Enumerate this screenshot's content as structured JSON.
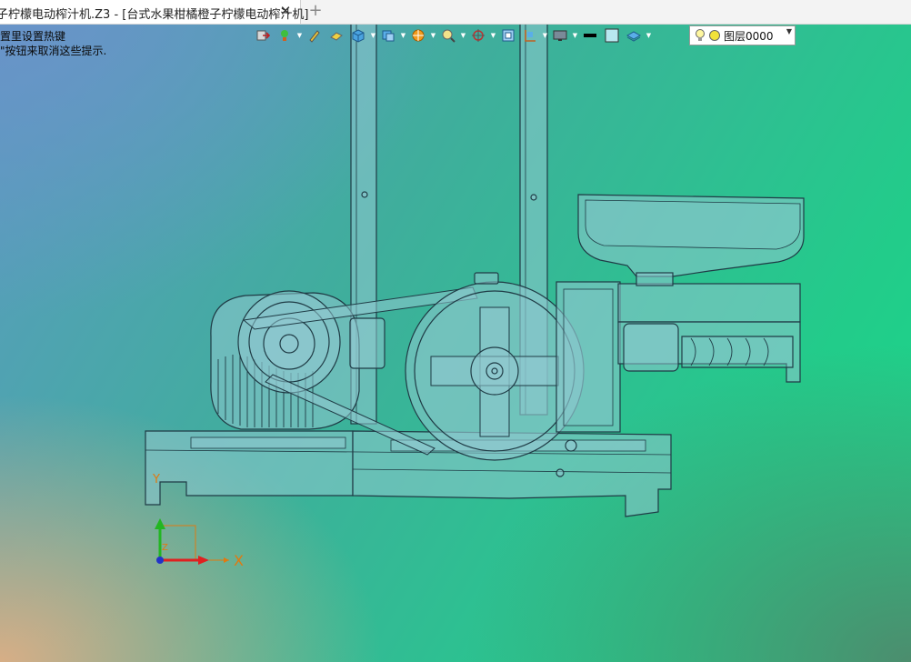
{
  "tabs": [
    {
      "label": "子柠檬电动榨汁机.Z3 - [台式水果柑橘橙子柠檬电动榨汁机]",
      "active": true
    }
  ],
  "tab_close_glyph": "✕",
  "tab_add_glyph": "+",
  "hint": {
    "line1": "置里设置热键",
    "line2": "\"按钮来取消这些提示."
  },
  "toolbar": {
    "icons": [
      "move-icon",
      "light-icon",
      "pen-icon",
      "shading-icon",
      "cube-view-icon",
      "view-cube-icon",
      "render-style-icon",
      "zoom-fit-icon",
      "orbit-icon",
      "frame-icon",
      "display-mode-icon",
      "monitor-icon",
      "line-color-icon",
      "fill-color-icon",
      "layer-stack-icon"
    ]
  },
  "layer_selector": {
    "value": "图层0000",
    "icons": [
      "bulb-icon",
      "layer-status-icon"
    ]
  },
  "axis": {
    "x_label": "X",
    "y_label": "Y",
    "z_label": "Z"
  },
  "colors": {
    "model_fill": "#7cbfcb",
    "model_stroke": "#1f3b45",
    "axis_x": "#e02020",
    "axis_y": "#22b622",
    "axis_z": "#2232c8",
    "axis_guide": "#e07a10"
  }
}
